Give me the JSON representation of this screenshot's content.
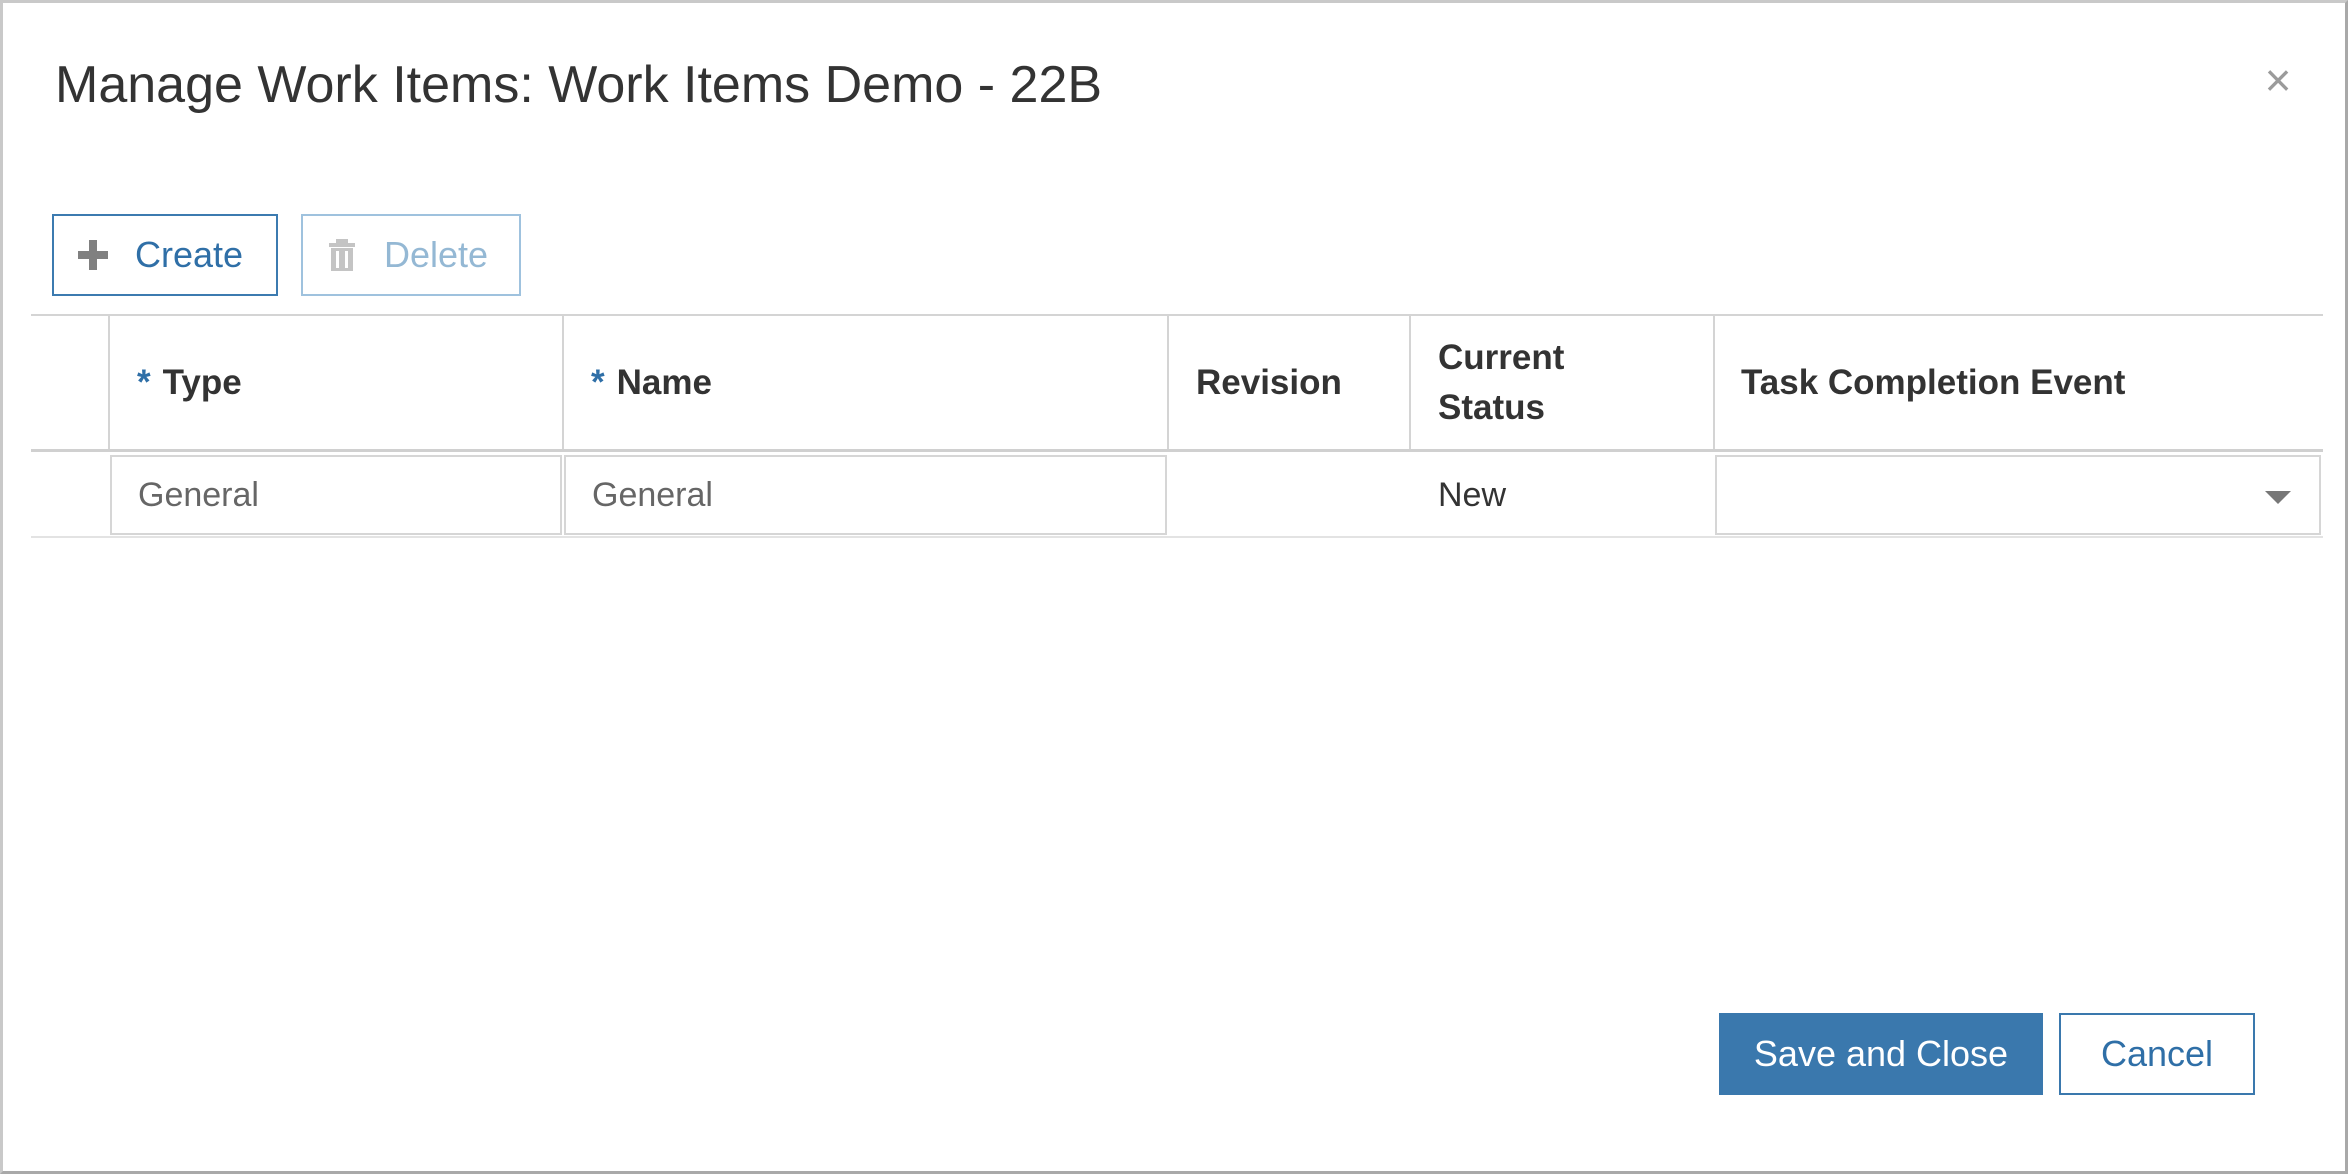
{
  "dialog": {
    "title": "Manage Work Items: Work Items Demo - 22B",
    "close_glyph": "×"
  },
  "toolbar": {
    "create_label": "Create",
    "delete_label": "Delete",
    "create_icon": "plus-icon",
    "delete_icon": "trash-icon"
  },
  "table": {
    "required_marker": "*",
    "columns": {
      "type": "Type",
      "name": "Name",
      "revision": "Revision",
      "status_line1": "Current",
      "status_line2": "Status",
      "task_completion_event": "Task Completion Event"
    },
    "rows": [
      {
        "type": "General",
        "name": "General",
        "revision": "",
        "status": "New",
        "task_completion_event": ""
      }
    ]
  },
  "footer": {
    "save_label": "Save and Close",
    "cancel_label": "Cancel"
  },
  "colors": {
    "accent": "#3a78ad",
    "disabled": "#94b8d4"
  }
}
